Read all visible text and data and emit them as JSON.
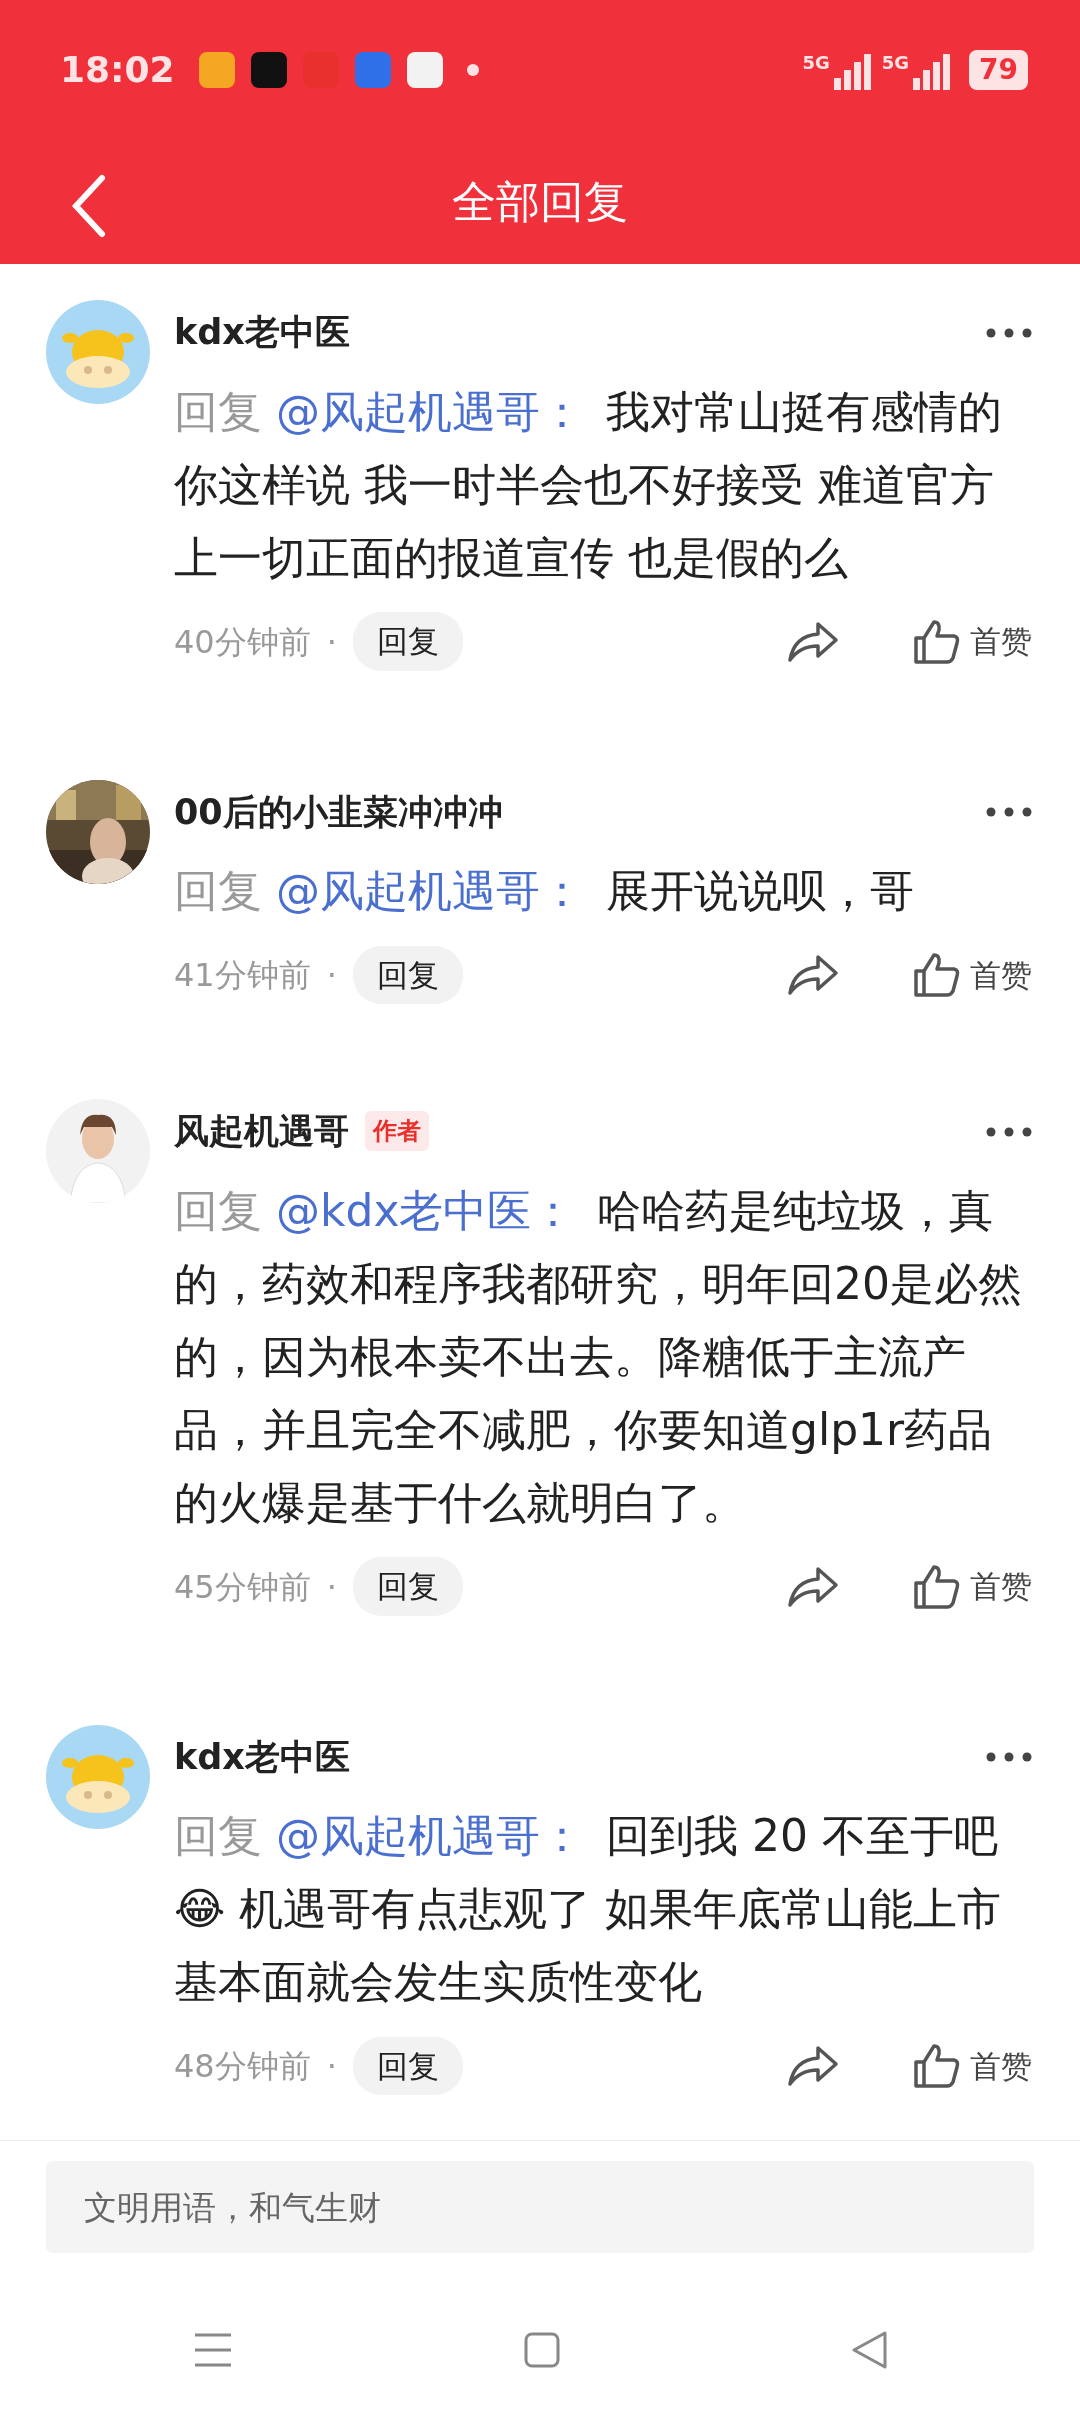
{
  "status_bar": {
    "time": "18:02",
    "app_icons": [
      {
        "color": "#f5a623"
      },
      {
        "color": "#111111"
      },
      {
        "color": "#e8302d"
      },
      {
        "color": "#2f6fe8"
      },
      {
        "color": "#f2f2f2"
      }
    ],
    "network_1": "5G",
    "network_2": "5G",
    "battery": "79"
  },
  "header": {
    "title": "全部回复"
  },
  "comments": [
    {
      "avatar": {
        "kind": "cow"
      },
      "user": "kdx老中医",
      "reply_prefix": "回复",
      "mention": "@风起机遇哥：",
      "text": "我对常山挺有感情的你这样说 我一时半会也不好接受 难道官方上一切正面的报道宣传 也是假的么",
      "time": "40分钟前",
      "separator": "·",
      "reply_button": "回复",
      "like_label": "首赞"
    },
    {
      "user": "00后的小韭菜冲冲冲",
      "reply_prefix": "回复",
      "mention": "@风起机遇哥：",
      "text": "展开说说呗，哥",
      "time": "41分钟前",
      "separator": "·",
      "reply_button": "回复",
      "like_label": "首赞"
    },
    {
      "avatar": {
        "kind": "person"
      },
      "user": "风起机遇哥",
      "author_badge": "作者",
      "reply_prefix": "回复",
      "mention": "@kdx老中医：",
      "text": "哈哈药是纯垃圾，真的，药效和程序我都研究，明年回20是必然的，因为根本卖不出去。降糖低于主流产品，并且完全不减肥，你要知道glp1r药品的火爆是基于什么就明白了。",
      "time": "45分钟前",
      "separator": "·",
      "reply_button": "回复",
      "like_label": "首赞"
    },
    {
      "avatar": {
        "kind": "cow"
      },
      "user": "kdx老中医",
      "reply_prefix": "回复",
      "mention": "@风起机遇哥：",
      "text": "回到我 20 不至于吧😂 机遇哥有点悲观了 如果年底常山能上市基本面就会发生实质性变化",
      "time": "48分钟前",
      "separator": "·",
      "reply_button": "回复",
      "like_label": "首赞"
    }
  ],
  "footer": {
    "input": {
      "placeholder": "文明用语，和气生财"
    }
  }
}
